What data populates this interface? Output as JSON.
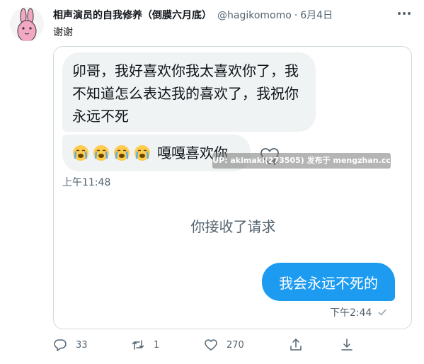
{
  "tweet": {
    "author_name": "相声演员的自我修养（倒膜六月底）",
    "author_handle": "@hagikomomo",
    "separator": "·",
    "date": "6月4日",
    "text": "谢谢"
  },
  "dm": {
    "incoming_1": "卯哥，我好喜欢你我太喜欢你了，我不知道怎么表达我的喜欢了，我祝你永远不死",
    "incoming_2": "嘎嘎喜欢你",
    "incoming_time": "上午11:48",
    "system_message": "你接收了请求",
    "outgoing": "我会永远不死的",
    "outgoing_time": "下午2:44",
    "watermark": "UP: akimaki(273505) 发布于 mengzhan.cc"
  },
  "actions": {
    "reply_count": "33",
    "retweet_count": "1",
    "like_count": "270"
  },
  "icons": {
    "avatar": "pink-rabbit-avatar",
    "more": "more-icon",
    "emoji": "crying-face-emoji",
    "react": "heart-react-icon",
    "read_receipt": "check-icon",
    "reply": "reply-icon",
    "retweet": "retweet-icon",
    "like": "heart-icon",
    "share": "share-icon",
    "download": "download-icon"
  },
  "colors": {
    "accent": "#1d9bf0",
    "incoming_bubble": "#eff3f4",
    "secondary_text": "#536471",
    "border": "#cfd9de"
  }
}
